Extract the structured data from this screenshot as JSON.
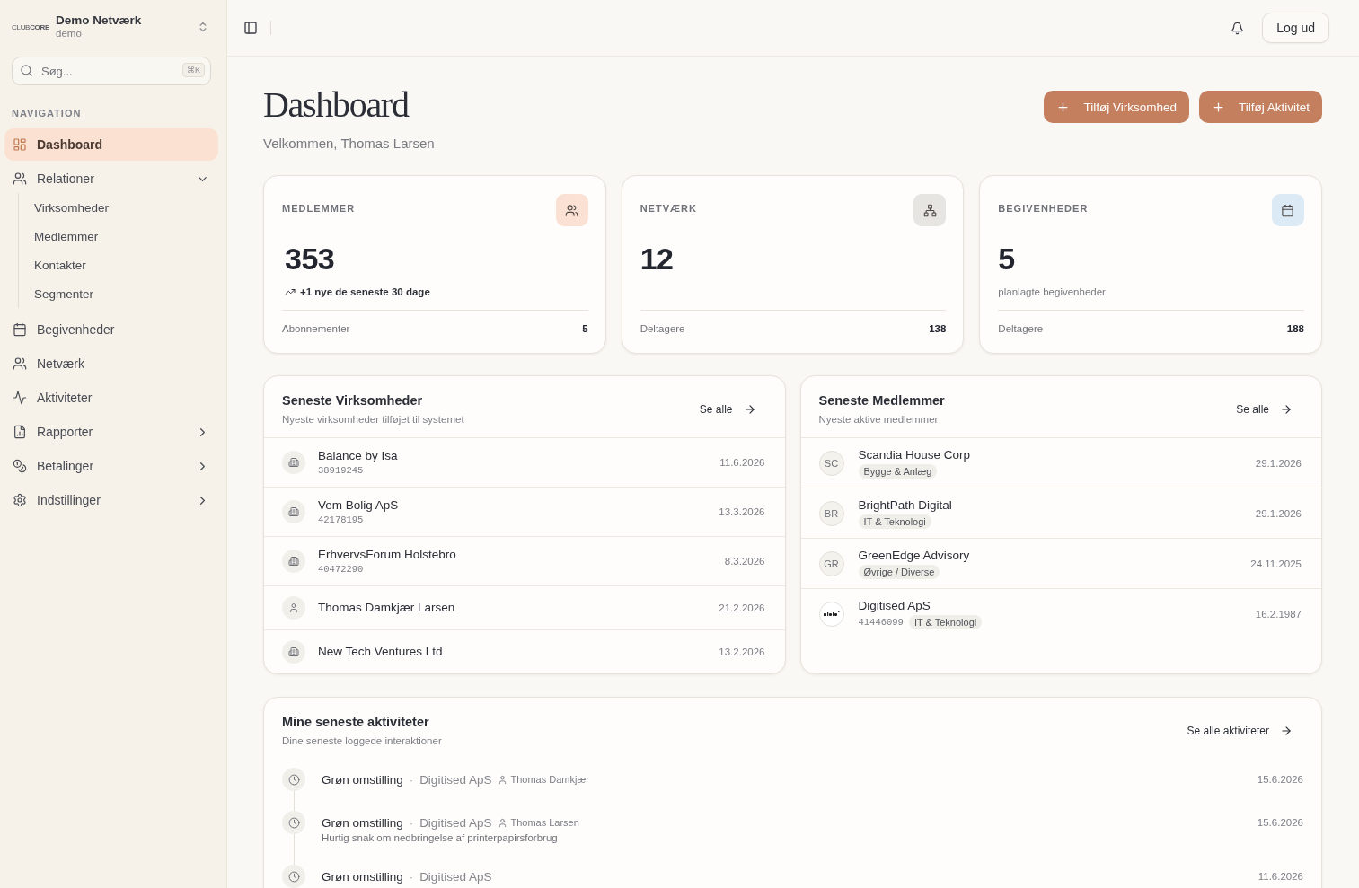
{
  "sidebar": {
    "brand": {
      "logo": "CLUB**CORE**",
      "name": "Demo Netværk",
      "subtitle": "demo"
    },
    "search": {
      "placeholder": "Søg...",
      "shortcut": "⌘K"
    },
    "section_title": "NAVIGATION",
    "items": [
      {
        "label": "Dashboard",
        "selected": true
      },
      {
        "label": "Relationer",
        "selected": false,
        "expanded": true,
        "children": [
          {
            "label": "Virksomheder",
            "selected": false
          },
          {
            "label": "Medlemmer",
            "selected": false
          },
          {
            "label": "Kontakter",
            "selected": false
          },
          {
            "label": "Segmenter",
            "selected": false
          }
        ]
      },
      {
        "label": "Begivenheder",
        "selected": false
      },
      {
        "label": "Netværk",
        "selected": false
      },
      {
        "label": "Aktiviteter",
        "selected": false
      },
      {
        "label": "Rapporter",
        "selected": false,
        "expanded": false
      },
      {
        "label": "Betalinger",
        "selected": false,
        "expanded": false
      },
      {
        "label": "Indstillinger",
        "selected": false,
        "expanded": false
      }
    ]
  },
  "topbar": {
    "logout_button": "Log ud"
  },
  "page_header": {
    "title": "Dashboard",
    "greeting": "Velkommen, Thomas Larsen",
    "actions": [
      "Tilføj Virksomhed",
      "Tilføj Aktivitet"
    ]
  },
  "stats": [
    {
      "label": "MEDLEMMER",
      "value": "353",
      "note": {
        "kind": "trend",
        "text": "+1 nye de seneste 30 dage"
      },
      "footer_label": "Abonnementer",
      "footer_value": "5",
      "color": "#fbe1d3"
    },
    {
      "label": "NETVÆRK",
      "value": "12",
      "footer_label": "Deltagere",
      "footer_value": "138",
      "color": "#e6e5e2"
    },
    {
      "label": "BEGIVENHEDER",
      "value": "5",
      "note": {
        "kind": "plain",
        "text": "planlagte begivenheder"
      },
      "footer_label": "Deltagere",
      "footer_value": "188",
      "color": "#dceaf6"
    }
  ],
  "recent_companies": {
    "title": "Seneste Virksomheder",
    "subtitle": "Nyeste virksomheder tilføjet til systemet",
    "link": "Se alle",
    "rows": [
      {
        "kind": "company",
        "name": "Balance by Isa",
        "number": "38919245",
        "date": "11.6.2026"
      },
      {
        "kind": "company",
        "name": "Vem Bolig ApS",
        "number": "42178195",
        "date": "13.3.2026"
      },
      {
        "kind": "company",
        "name": "ErhvervsForum Holstebro",
        "number": "40472290",
        "date": "8.3.2026"
      },
      {
        "kind": "person",
        "name": "Thomas Damkjær Larsen",
        "date": "21.2.2026"
      },
      {
        "kind": "company",
        "name": "New Tech Ventures Ltd",
        "date": "13.2.2026"
      }
    ]
  },
  "recent_members": {
    "title": "Seneste Medlemmer",
    "subtitle": "Nyeste aktive medlemmer",
    "link": "Se alle",
    "rows": [
      {
        "kind": "initials",
        "initials": "SC",
        "name": "Scandia House Corp",
        "tag": "Bygge & Anlæg",
        "date": "29.1.2026"
      },
      {
        "kind": "initials",
        "initials": "BR",
        "name": "BrightPath Digital",
        "tag": "IT & Teknologi",
        "date": "29.1.2026"
      },
      {
        "kind": "initials",
        "initials": "GR",
        "name": "GreenEdge Advisory",
        "tag": "Øvrige / Diverse",
        "date": "24.11.2025"
      },
      {
        "kind": "logo",
        "name": "Digitised ApS",
        "number": "41446099",
        "tag": "IT & Teknologi",
        "date": "16.2.1987"
      }
    ]
  },
  "activities": {
    "title": "Mine seneste aktiviteter",
    "subtitle": "Dine seneste loggede interaktioner",
    "link": "Se alle aktiviteter",
    "items": [
      {
        "title": "Grøn omstilling",
        "separator": "·",
        "company": "Digitised ApS",
        "person": "Thomas Damkjær",
        "date": "15.6.2026"
      },
      {
        "title": "Grøn omstilling",
        "separator": "·",
        "company": "Digitised ApS",
        "person": "Thomas Larsen",
        "description": "Hurtig snak om nedbringelse af printerpapirsforbrug",
        "date": "15.6.2026"
      },
      {
        "title": "Grøn omstilling",
        "separator": "·",
        "company": "Digitised ApS",
        "date": "11.6.2026"
      }
    ]
  }
}
